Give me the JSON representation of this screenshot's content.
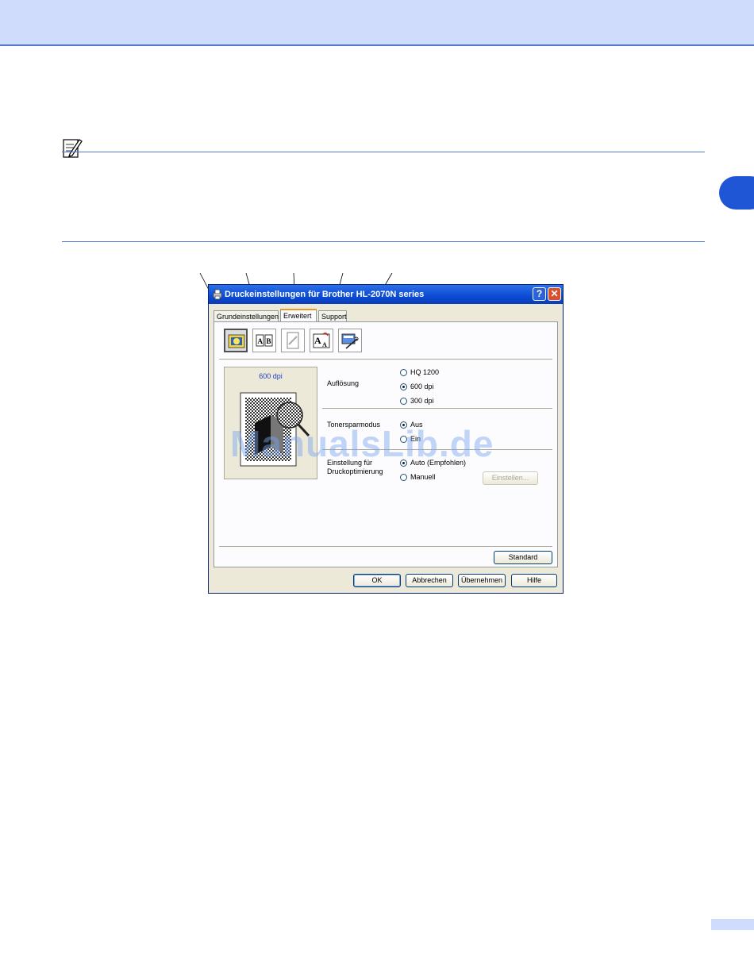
{
  "dialog": {
    "title": "Druckeinstellungen für Brother HL-2070N series",
    "help_glyph": "?",
    "close_glyph": "✕",
    "tabs": [
      {
        "label": "Grundeinstellungen",
        "active": false
      },
      {
        "label": "Erweitert",
        "active": true
      },
      {
        "label": "Support",
        "active": false
      }
    ],
    "toolbar": [
      {
        "icon": "print-quality-icon",
        "active": true
      },
      {
        "icon": "duplex-icon",
        "active": false
      },
      {
        "icon": "watermark-icon",
        "active": false
      },
      {
        "icon": "page-setting-icon",
        "active": false
      },
      {
        "icon": "device-options-icon",
        "active": false
      }
    ],
    "preview": {
      "resolution_label": "600 dpi"
    },
    "resolution": {
      "label": "Auflösung",
      "options": [
        {
          "label": "HQ 1200",
          "selected": false
        },
        {
          "label": "600 dpi",
          "selected": true
        },
        {
          "label": "300 dpi",
          "selected": false
        }
      ]
    },
    "toner_save": {
      "label": "Tonersparmodus",
      "options": [
        {
          "label": "Aus",
          "selected": true
        },
        {
          "label": "Ein",
          "selected": false
        }
      ]
    },
    "print_optimization": {
      "label_line1": "Einstellung für",
      "label_line2": "Druckoptimierung",
      "options": [
        {
          "label": "Auto (Empfohlen)",
          "selected": true
        },
        {
          "label": "Manuell",
          "selected": false
        }
      ],
      "settings_button": "Einstellen..."
    },
    "standard_button": "Standard",
    "footer_buttons": {
      "ok": "OK",
      "cancel": "Abbrechen",
      "apply": "Übernehmen",
      "help": "Hilfe"
    }
  },
  "watermark_text": "ManualsLib.de",
  "colors": {
    "accent_blue": "#1f56d6",
    "band_blue": "#cfdcfb",
    "rule_blue": "#5577d0"
  }
}
